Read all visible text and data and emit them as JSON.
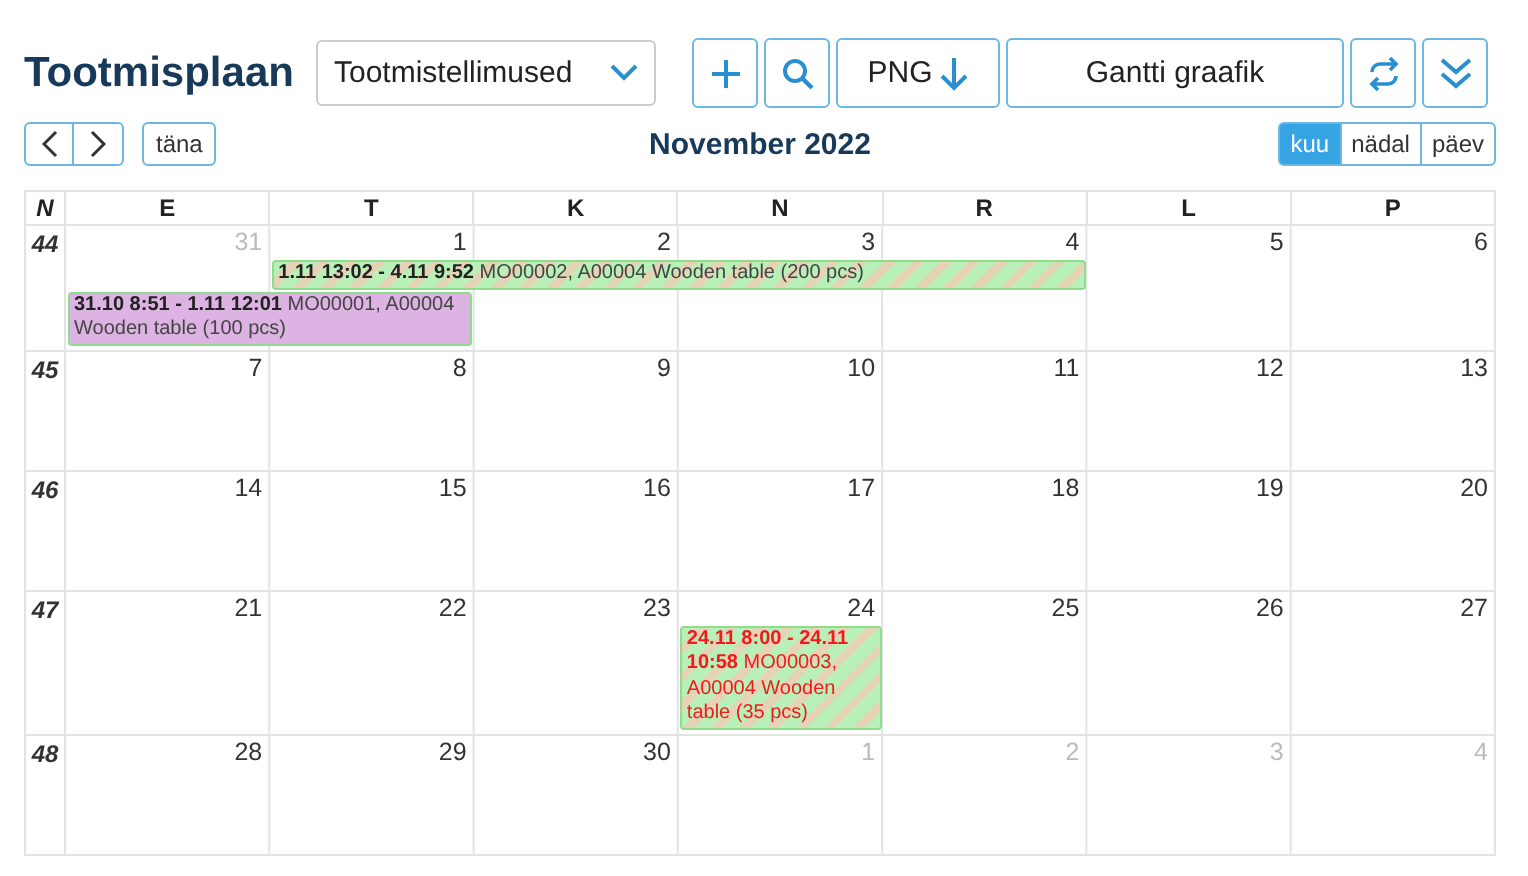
{
  "title": "Tootmisplaan",
  "source_select": {
    "value": "Tootmistellimused"
  },
  "toolbar": [
    {
      "kind": "add"
    },
    {
      "kind": "search"
    },
    {
      "kind": "export",
      "label": "PNG"
    },
    {
      "kind": "text",
      "label": "Gantti graafik"
    },
    {
      "kind": "refresh"
    },
    {
      "kind": "collapse"
    }
  ],
  "nav": {
    "today": "täna"
  },
  "period": "November 2022",
  "views": [
    {
      "label": "kuu",
      "selected": true
    },
    {
      "label": "nädal",
      "selected": false
    },
    {
      "label": "päev",
      "selected": false
    }
  ],
  "calendar": {
    "week_header": "N",
    "days": [
      "E",
      "T",
      "K",
      "N",
      "R",
      "L",
      "P"
    ],
    "weeks": [
      {
        "number": "44",
        "dates": [
          {
            "label": "31",
            "muted": true,
            "events": [
              {
                "kind": "solid",
                "late": false,
                "color": "#dcb3e2",
                "time": "31.10 8:51 - 1.11 12:01",
                "text": "MO00001, A00004 Wooden table (100 pcs)"
              }
            ]
          },
          {
            "label": "1",
            "muted": false,
            "events": [
              {
                "kind": "striped",
                "late": false,
                "color": "#b8f0b8",
                "time": "1.11 13:02 - 4.11 9:52",
                "text": "MO00002, A00004 Wooden table (200 pcs)"
              }
            ]
          },
          {
            "label": "2",
            "muted": false
          },
          {
            "label": "3",
            "muted": false
          },
          {
            "label": "4",
            "muted": false
          },
          {
            "label": "5",
            "muted": false
          },
          {
            "label": "6",
            "muted": false
          }
        ]
      },
      {
        "number": "45",
        "dates": [
          {
            "label": "7",
            "muted": false
          },
          {
            "label": "8",
            "muted": false
          },
          {
            "label": "9",
            "muted": false
          },
          {
            "label": "10",
            "muted": false
          },
          {
            "label": "11",
            "muted": false
          },
          {
            "label": "12",
            "muted": false
          },
          {
            "label": "13",
            "muted": false
          }
        ]
      },
      {
        "number": "46",
        "dates": [
          {
            "label": "14",
            "muted": false
          },
          {
            "label": "15",
            "muted": false
          },
          {
            "label": "16",
            "muted": false
          },
          {
            "label": "17",
            "muted": false
          },
          {
            "label": "18",
            "muted": false
          },
          {
            "label": "19",
            "muted": false
          },
          {
            "label": "20",
            "muted": false
          }
        ]
      },
      {
        "number": "47",
        "dates": [
          {
            "label": "21",
            "muted": false
          },
          {
            "label": "22",
            "muted": false
          },
          {
            "label": "23",
            "muted": false
          },
          {
            "label": "24",
            "muted": false,
            "events": [
              {
                "kind": "striped",
                "late": true,
                "color": "#b8f0b8",
                "time": "24.11 8:00 - 24.11 10:58",
                "text": "MO00003, A00004 Wooden table (35 pcs)"
              }
            ]
          },
          {
            "label": "25",
            "muted": false
          },
          {
            "label": "26",
            "muted": false
          },
          {
            "label": "27",
            "muted": false
          }
        ]
      },
      {
        "number": "48",
        "dates": [
          {
            "label": "28",
            "muted": false
          },
          {
            "label": "29",
            "muted": false
          },
          {
            "label": "30",
            "muted": false
          },
          {
            "label": "1",
            "muted": true
          },
          {
            "label": "2",
            "muted": true
          },
          {
            "label": "3",
            "muted": true
          },
          {
            "label": "4",
            "muted": true
          }
        ]
      }
    ]
  }
}
